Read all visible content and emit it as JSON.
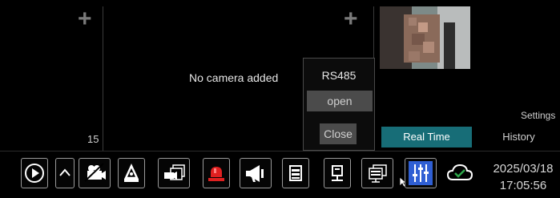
{
  "panes": {
    "left": {
      "channel_number": "15"
    },
    "center": {
      "message": "No camera added"
    }
  },
  "rs485_popup": {
    "title": "RS485",
    "open_label": "open",
    "close_label": "Close"
  },
  "right_panel": {
    "settings_label": "Settings",
    "tabs": [
      {
        "label": "Real Time",
        "active": true
      },
      {
        "label": "History",
        "active": false
      }
    ]
  },
  "toolbar": {
    "icons": [
      "playback-icon",
      "collapse-up-icon",
      "camera-alarm-icon",
      "manual-alarm-icon",
      "snapshot-icon",
      "alarm-light-icon",
      "audio-broadcast-icon",
      "disk-icon",
      "network-icon",
      "preview-windows-icon",
      "mixer-icon",
      "cloud-icon"
    ]
  },
  "datetime": {
    "date": "2025/03/18",
    "time": "17:05:56"
  },
  "colors": {
    "accent_tab": "#176d77",
    "alarm_red": "#e02020",
    "cloud_green": "#2ea84a",
    "mixer_blue": "#2f5fd4"
  }
}
